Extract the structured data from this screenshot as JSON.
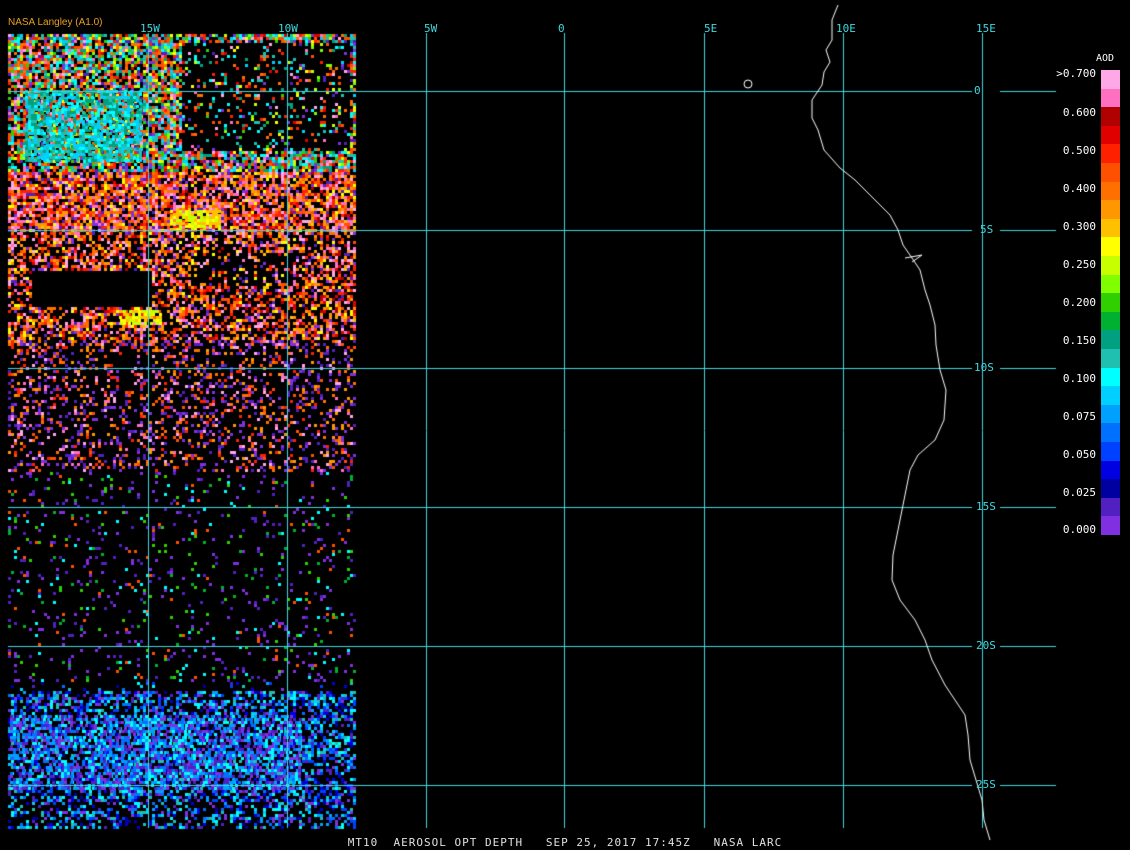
{
  "credit": "NASA Langley (A1.0)",
  "footer": "MT10  AEROSOL OPT DEPTH   SEP 25, 2017 17:45Z   NASA LARC",
  "lon_labels": [
    "15W",
    "10W",
    "5W",
    "0",
    "5E",
    "10E",
    "15E"
  ],
  "lat_labels": [
    "0",
    "5S",
    "10S",
    "15S",
    "20S",
    "25S"
  ],
  "legend": {
    "title": "AOD",
    "labels": [
      ">0.700",
      "0.600",
      "0.500",
      "0.400",
      "0.300",
      "0.250",
      "0.200",
      "0.150",
      "0.100",
      "0.075",
      "0.050",
      "0.025",
      "0.000"
    ],
    "colors": [
      "#ffa8e8",
      "#ff70c0",
      "#b00000",
      "#e00000",
      "#ff2000",
      "#ff5000",
      "#ff7000",
      "#ff9800",
      "#ffc000",
      "#ffff00",
      "#c8ff00",
      "#80ff00",
      "#30d000",
      "#00b030",
      "#00a080",
      "#20c0b0",
      "#00ffff",
      "#00d0ff",
      "#00a0ff",
      "#0070ff",
      "#0040ff",
      "#0000e0",
      "#0000a0",
      "#5020c0",
      "#8030e0"
    ]
  },
  "grid_color": "#3fd8e0",
  "coast_color": "#ffffff"
}
